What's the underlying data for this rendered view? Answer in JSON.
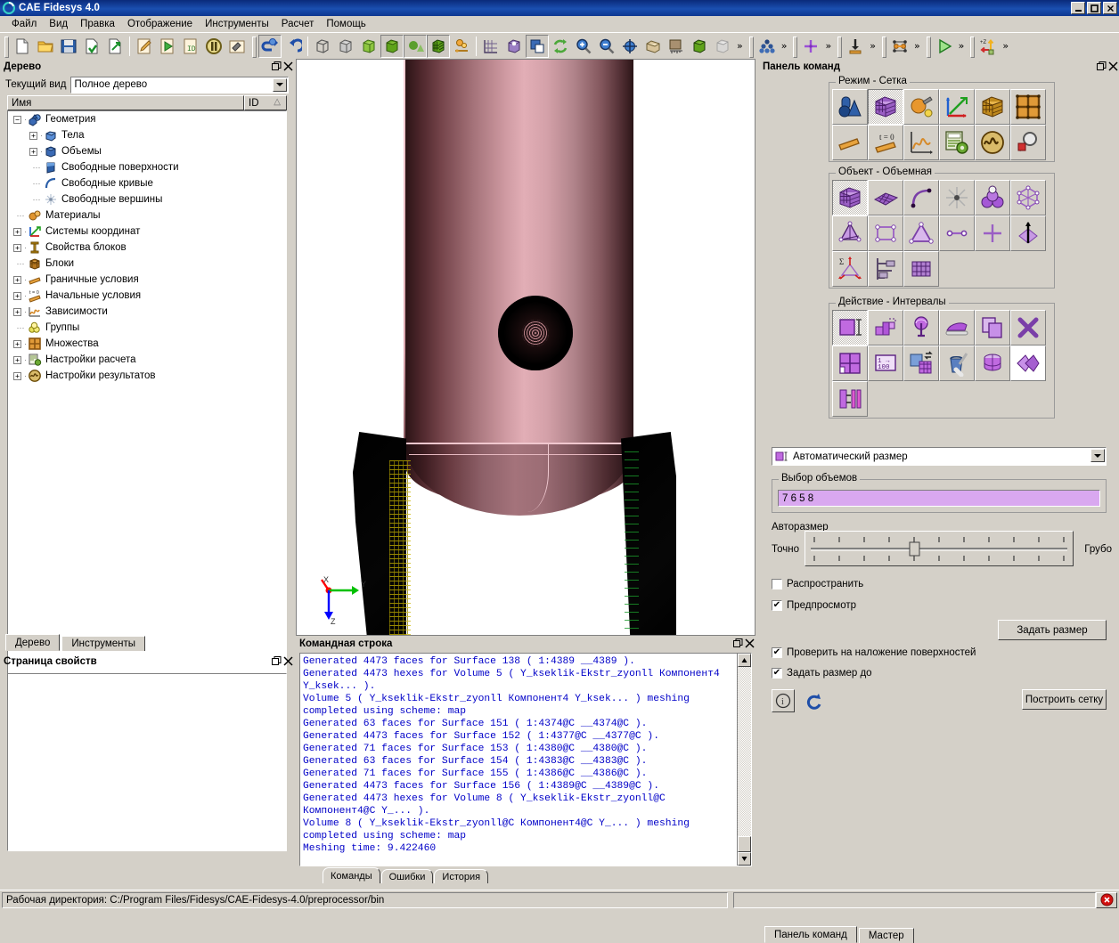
{
  "app": {
    "title": "CAE Fidesys 4.0",
    "icon": "fidesys-logo-icon",
    "window_buttons": {
      "minimize": "_",
      "maximize": "❐",
      "close": "✕"
    }
  },
  "menubar": {
    "items": [
      {
        "label": "Файл",
        "name": "menu-file"
      },
      {
        "label": "Вид",
        "name": "menu-view"
      },
      {
        "label": "Правка",
        "name": "menu-edit"
      },
      {
        "label": "Отображение",
        "name": "menu-display"
      },
      {
        "label": "Инструменты",
        "name": "menu-tools"
      },
      {
        "label": "Расчет",
        "name": "menu-analysis"
      },
      {
        "label": "Помощь",
        "name": "menu-help"
      }
    ]
  },
  "toolbar": {
    "groups": [
      {
        "name": "file-group",
        "buttons": [
          "new-file-icon",
          "open-folder-icon",
          "save-icon",
          "import-icon",
          "export-icon"
        ]
      },
      {
        "name": "journal-group",
        "buttons": [
          "edit-journal-icon",
          "play-journal-icon",
          "journal-id-icon",
          "pause-icon",
          "build-icon"
        ]
      },
      {
        "name": "undo-group",
        "buttons": [
          "reset-icon",
          "undo-icon"
        ]
      },
      {
        "name": "display-group",
        "buttons": [
          "wireframe-icon",
          "hiddenline-icon",
          "smoothshade-icon",
          "flatshade-icon",
          "transparent-icon",
          "mesh-icon",
          "light-icon",
          "grid-icon",
          "volume-icon",
          "overlap-icon",
          "refresh-icon",
          "zoom-in-icon",
          "zoom-out-icon",
          "fit-icon",
          "view-iso-icon",
          "view-front-icon",
          "ruler-icon",
          "view-cube-icon",
          "ghost-icon"
        ]
      },
      {
        "name": "mesh-group",
        "buttons": [
          "mesh-quality-icon"
        ]
      },
      {
        "name": "node-group",
        "buttons": [
          "node-icon"
        ]
      },
      {
        "name": "load-group",
        "buttons": [
          "load-arrow-icon"
        ]
      },
      {
        "name": "bc-group",
        "buttons": [
          "constraint-icon"
        ]
      },
      {
        "name": "run-group",
        "buttons": [
          "run-play-icon"
        ]
      },
      {
        "name": "axis-group",
        "buttons": [
          "axis-z-icon"
        ]
      }
    ],
    "overflow_label": "»"
  },
  "tree_panel": {
    "title": "Дерево",
    "restore_icon": "restore-icon",
    "close_icon": "close-icon",
    "current_view_label": "Текущий вид",
    "current_view_value": "Полное дерево",
    "columns": [
      {
        "label": "Имя",
        "name": "tree-col-name"
      },
      {
        "label": "ID",
        "name": "tree-col-id"
      }
    ],
    "sort_indicator": "△",
    "items": [
      {
        "label": "Геометрия",
        "depth": 0,
        "toggle": "minus",
        "icon": "geometry-icon"
      },
      {
        "label": "Тела",
        "depth": 1,
        "toggle": "plus",
        "icon": "bodies-icon"
      },
      {
        "label": "Объемы",
        "depth": 1,
        "toggle": "plus",
        "icon": "volumes-icon"
      },
      {
        "label": "Свободные поверхности",
        "depth": 1,
        "toggle": "none",
        "icon": "free-surfaces-icon"
      },
      {
        "label": "Свободные кривые",
        "depth": 1,
        "toggle": "none",
        "icon": "free-curves-icon"
      },
      {
        "label": "Свободные вершины",
        "depth": 1,
        "toggle": "none",
        "icon": "free-vertices-icon"
      },
      {
        "label": "Материалы",
        "depth": 0,
        "toggle": "none",
        "icon": "materials-icon"
      },
      {
        "label": "Системы координат",
        "depth": 0,
        "toggle": "plus",
        "icon": "coordinate-systems-icon"
      },
      {
        "label": "Свойства блоков",
        "depth": 0,
        "toggle": "plus",
        "icon": "block-properties-icon"
      },
      {
        "label": "Блоки",
        "depth": 0,
        "toggle": "none",
        "icon": "blocks-icon"
      },
      {
        "label": "Граничные условия",
        "depth": 0,
        "toggle": "plus",
        "icon": "boundary-conditions-icon"
      },
      {
        "label": "Начальные условия",
        "depth": 0,
        "toggle": "plus",
        "icon": "initial-conditions-icon"
      },
      {
        "label": "Зависимости",
        "depth": 0,
        "toggle": "plus",
        "icon": "dependencies-icon"
      },
      {
        "label": "Группы",
        "depth": 0,
        "toggle": "none",
        "icon": "groups-icon"
      },
      {
        "label": "Множества",
        "depth": 0,
        "toggle": "plus",
        "icon": "sets-icon"
      },
      {
        "label": "Настройки расчета",
        "depth": 0,
        "toggle": "plus",
        "icon": "solver-settings-icon"
      },
      {
        "label": "Настройки результатов",
        "depth": 0,
        "toggle": "plus",
        "icon": "results-settings-icon"
      }
    ]
  },
  "left_tabs": [
    {
      "label": "Дерево",
      "name": "tab-tree",
      "active": true
    },
    {
      "label": "Инструменты",
      "name": "tab-tools",
      "active": false
    }
  ],
  "properties_panel": {
    "title": "Страница свойств",
    "restore_icon": "restore-icon",
    "close_icon": "close-icon",
    "content": ""
  },
  "viewport": {
    "name": "3d-viewport",
    "triad": {
      "x_label": "X",
      "y_label": "Y",
      "z_label": "Z",
      "x_color": "#ff0000",
      "y_color": "#00c000",
      "z_color": "#0000ff"
    },
    "model_color": "#e2aeb6"
  },
  "console": {
    "title": "Командная строка",
    "restore_icon": "restore-icon",
    "close_icon": "close-icon",
    "text": "Generated 4473 faces for Surface 138 ( 1:4389 __4389 ).\nGenerated 4473 hexes for Volume 5 ( Y_kseklik-Ekstr_zyonll Компонент4 Y_ksek... ).\nVolume 5 ( Y_kseklik-Ekstr_zyonll Компонент4 Y_ksek... ) meshing completed using scheme: map\nGenerated 63 faces for Surface 151 ( 1:4374@C __4374@C ).\nGenerated 4473 faces for Surface 152 ( 1:4377@C __4377@C ).\nGenerated 71 faces for Surface 153 ( 1:4380@C __4380@C ).\nGenerated 63 faces for Surface 154 ( 1:4383@C __4383@C ).\nGenerated 71 faces for Surface 155 ( 1:4386@C __4386@C ).\nGenerated 4473 faces for Surface 156 ( 1:4389@C __4389@C ).\nGenerated 4473 hexes for Volume 8 ( Y_kseklik-Ekstr_zyonll@C Компонент4@C Y_... ).\nVolume 8 ( Y_kseklik-Ekstr_zyonll@C Компонент4@C Y_... ) meshing completed using scheme: map\nMeshing time: 9.422460",
    "text_color": "#0000c8",
    "tabs": [
      {
        "label": "Команды",
        "name": "console-tab-commands",
        "active": true
      },
      {
        "label": "Ошибки",
        "name": "console-tab-errors",
        "active": false
      },
      {
        "label": "История",
        "name": "console-tab-history",
        "active": false
      }
    ]
  },
  "command_panel": {
    "title": "Панель команд",
    "restore_icon": "restore-icon",
    "close_icon": "close-icon",
    "mode_group": {
      "caption": "Режим - Сетка",
      "buttons": [
        {
          "icon": "geometry-mode-icon",
          "selected": false
        },
        {
          "icon": "mesh-mode-icon",
          "selected": true
        },
        {
          "icon": "material-mode-icon",
          "selected": false
        },
        {
          "icon": "coordinate-mode-icon",
          "selected": false
        },
        {
          "icon": "block-mode-icon",
          "selected": false
        },
        {
          "icon": "sets-mode-icon",
          "selected": false
        },
        {
          "icon": "boundary-condition-icon",
          "selected": false
        },
        {
          "icon": "initial-condition-icon",
          "selected": false
        },
        {
          "icon": "dependency-curve-icon",
          "selected": false
        },
        {
          "icon": "solver-settings-icon",
          "selected": false
        },
        {
          "icon": "results-settings-icon",
          "selected": false
        },
        {
          "icon": "inspect-icon",
          "selected": false
        }
      ]
    },
    "object_group": {
      "caption": "Объект - Объемная",
      "buttons": [
        {
          "icon": "volume-object-icon",
          "selected": true
        },
        {
          "icon": "surface-object-icon",
          "selected": false
        },
        {
          "icon": "curve-object-icon",
          "selected": false
        },
        {
          "icon": "vertex-object-icon",
          "selected": false
        },
        {
          "icon": "group-object-icon",
          "selected": false
        },
        {
          "icon": "node-object-icon",
          "selected": false
        },
        {
          "icon": "tet-object-icon",
          "selected": false
        },
        {
          "icon": "quad-object-icon",
          "selected": false
        },
        {
          "icon": "tri-object-icon",
          "selected": false
        },
        {
          "icon": "edge-object-icon",
          "selected": false
        },
        {
          "icon": "node-cross-icon",
          "selected": false
        },
        {
          "icon": "sweep-object-icon",
          "selected": false
        },
        {
          "icon": "sum-object-icon",
          "selected": false
        },
        {
          "icon": "hierarchy-icon",
          "selected": false
        },
        {
          "icon": "grid-object-icon",
          "selected": false
        }
      ]
    },
    "action_group": {
      "caption": "Действие - Интервалы",
      "buttons": [
        {
          "icon": "interval-size-icon",
          "selected": true
        },
        {
          "icon": "bias-icon",
          "selected": false
        },
        {
          "icon": "sphere-scheme-icon",
          "selected": false
        },
        {
          "icon": "smooth-iron-icon",
          "selected": false
        },
        {
          "icon": "copy-mesh-icon",
          "selected": false
        },
        {
          "icon": "delete-mesh-icon",
          "selected": false
        },
        {
          "icon": "refine-icon",
          "selected": false
        },
        {
          "icon": "renumber-icon",
          "selected": false
        },
        {
          "icon": "convert-icon",
          "selected": false
        },
        {
          "icon": "paint-icon",
          "selected": false
        },
        {
          "icon": "sweep-mesh-icon",
          "selected": false
        },
        {
          "icon": "mesh-quality-icon",
          "selected": false
        },
        {
          "icon": "compare-intervals-icon",
          "selected": false
        }
      ]
    },
    "scheme_combo": {
      "icon": "interval-size-icon",
      "value": "Автоматический размер",
      "name": "scheme-combo"
    },
    "volume_selection": {
      "caption": "Выбор объемов",
      "value": "7 6 5 8",
      "highlight_color": "#d9a8f0"
    },
    "autosize": {
      "label": "Авторазмер",
      "min_label": "Точно",
      "max_label": "Грубо",
      "value": 4,
      "ticks": 10
    },
    "checkboxes": [
      {
        "label": "Распространить",
        "checked": false,
        "name": "propagate-checkbox"
      },
      {
        "label": "Предпросмотр",
        "checked": true,
        "name": "preview-checkbox"
      },
      {
        "label": "Проверить на наложение поверхностей",
        "checked": true,
        "name": "check-overlap-checkbox"
      },
      {
        "label": "Задать размер до",
        "checked": true,
        "name": "set-size-before-checkbox"
      }
    ],
    "set_size_button": "Задать размер",
    "build_mesh_button": "Построить сетку",
    "info_icon": "info-icon",
    "reset_icon": "reset-icon"
  },
  "right_tabs": [
    {
      "label": "Панель команд",
      "name": "tab-command-panel",
      "active": true
    },
    {
      "label": "Мастер",
      "name": "tab-wizard",
      "active": false
    }
  ],
  "statusbar": {
    "working_directory": "Рабочая директория: C:/Program Files/Fidesys/CAE-Fidesys-4.0/preprocessor/bin",
    "error_icon": "error-stop-icon"
  }
}
